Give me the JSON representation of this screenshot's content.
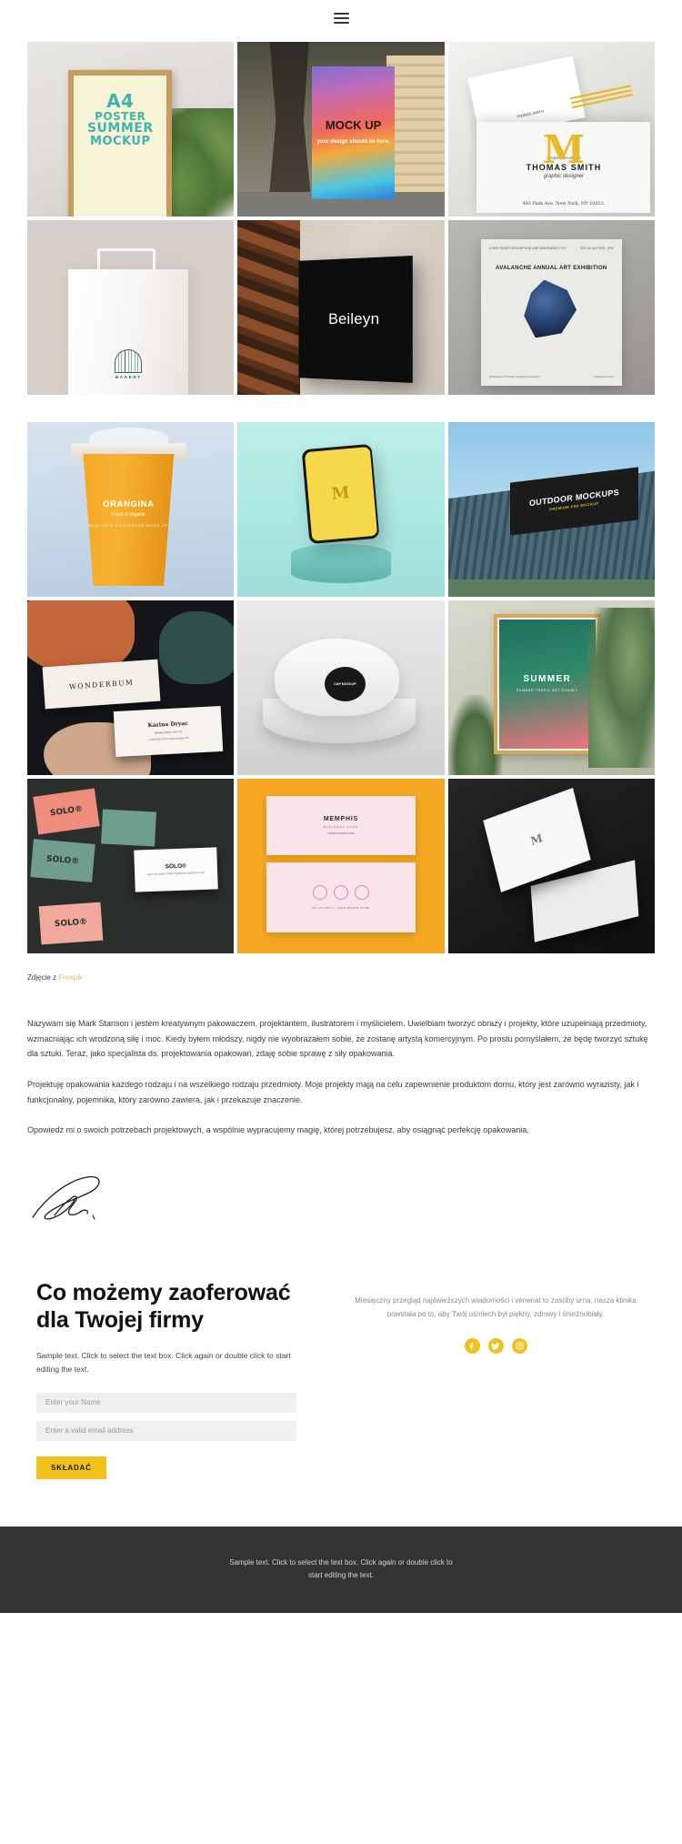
{
  "header": {
    "menu_label": "menu"
  },
  "gallery_top": {
    "tiles": [
      {
        "name": "a4-poster-summer-mockup",
        "lines": {
          "l1": "A4",
          "l2": "POSTER",
          "l3": "SUMMER",
          "l4": "MOCKUP"
        }
      },
      {
        "name": "street-billboard-mockup",
        "headline": "MOCK UP",
        "sub": "your design should be here."
      },
      {
        "name": "business-card-thomas-smith",
        "email": "company@mail.com",
        "monogram": "M",
        "person": "THOMAS SMITH",
        "role": "graphic designer",
        "address": "483 Park Ave, New York, NY 10022,",
        "stack_name": "THOMAS SMITH"
      },
      {
        "name": "bakery-paper-bag",
        "logo_text": "BAKERY"
      },
      {
        "name": "beileyn-storefront-sign",
        "sign_text": "Beileyn"
      },
      {
        "name": "avalanche-art-exhibition-poster",
        "meta_left": "A VERY SHORT\nDESCRIPTION LINE\nSUBHEADING TEXT",
        "meta_right": "2020\n06 JULY\n9PM - 3PM",
        "title": "AVALANCHE ANNUAL\nART EXHIBITION",
        "foot_left": "Showcasing of the finest of Avalanche annual art",
        "foot_right": "avalanche-art.com"
      }
    ]
  },
  "gallery_bottom": {
    "tiles": [
      {
        "name": "orangina-coffee-cup-mockup",
        "brand": "ORANGINA",
        "tagline": "Fresh & Organic",
        "lines": "REALISTIC\nPHOTOSHOP\nMOCK-UP"
      },
      {
        "name": "phone-on-pedestal-mockup",
        "screen_letter": "M"
      },
      {
        "name": "outdoor-billboard-mockup",
        "headline": "OUTDOOR MOCKUPS",
        "sub": "PREMIUM PSD MOCKUP"
      },
      {
        "name": "wonderbum-stationery",
        "card_title": "WONDERBUM",
        "person": "Karina Dryac",
        "sub": "BRAND DIRECTOR / ID",
        "contact": "+1 202 555 0147\nwww.example.com"
      },
      {
        "name": "cap-mockup",
        "patch_text": "CAP MOCKUP"
      },
      {
        "name": "summer-poster-plants",
        "title": "SUMMER",
        "sub": "SUMMER TROPIC\nART EXHIBIT"
      },
      {
        "name": "solo-branding-set",
        "badge": "SOLO®",
        "card_title": "SOLO®",
        "card_sub": "SEE US LABEL & PRINT\nWWW.SOLODESIGN.COM"
      },
      {
        "name": "memphis-business-card",
        "card_title": "MEMPHIS",
        "card_sub": "BUSINESS CARD",
        "card_url": "WWW.EXAMPLE.COM",
        "footer": "00-123-4567  |  YOUR BRAND NAME"
      },
      {
        "name": "dark-envelope-mockup",
        "monogram": "M"
      }
    ]
  },
  "attribution": {
    "prefix": "Zdjęcie z ",
    "link_label": "Freepik",
    "link_color": "#d9c66a"
  },
  "bio": {
    "paragraphs": [
      "Nazywam się Mark Stanson i jestem kreatywnym pakowaczem, projektantem, ilustratorem i myślicielem. Uwielbiam tworzyć obrazy i projekty, które uzupełniają przedmioty, wzmacniając ich wrodzoną siłę i moc. Kiedy byłem młodszy, nigdy nie wyobrażałem sobie, że zostanę artystą komercyjnym. Po prostu pomyślałem, że będę tworzyć sztukę dla sztuki. Teraz, jako specjalista ds. projektowania opakowań, zdaję sobie sprawę z siły opakowania.",
      "Projektuję opakowania każdego rodzaju i na wszelkiego rodzaju przedmioty. Moje projekty mają na celu zapewnienie produktom domu, który jest zarówno wyrazisty, jak i funkcjonalny, pojemnika, który zarówno zawiera, jak i przekazuje znaczenie.",
      "Opowiedz mi o swoich potrzebach projektowych, a wspólnie wypracujemy magię, której potrzebujesz, aby osiągnąć perfekcję opakowania."
    ]
  },
  "offer": {
    "title": "Co możemy zaoferować dla Twojej firmy",
    "subtitle": "Sample text. Click to select the text box. Click again or double click to start editing the text.",
    "name_placeholder": "Enter your Name",
    "name_value": "",
    "email_placeholder": "Enter a valid email address",
    "email_value": "",
    "submit_label": "SKŁADAĆ",
    "submit_color": "#f2c11c",
    "side_text": "Miesięczny przegląd najświeższych wiadomości i venenat to zasoby urna. nasza klinika powstała po to, aby Twój uśmiech był piękny, zdrowy i śnieżnobiały.",
    "socials": [
      {
        "name": "facebook",
        "label": "Facebook"
      },
      {
        "name": "twitter",
        "label": "Twitter"
      },
      {
        "name": "instagram",
        "label": "Instagram"
      }
    ],
    "social_color": "#f2c11c"
  },
  "footer": {
    "text": "Sample text. Click to select the text box. Click again or double click to start editing the text.",
    "background": "#333333"
  }
}
